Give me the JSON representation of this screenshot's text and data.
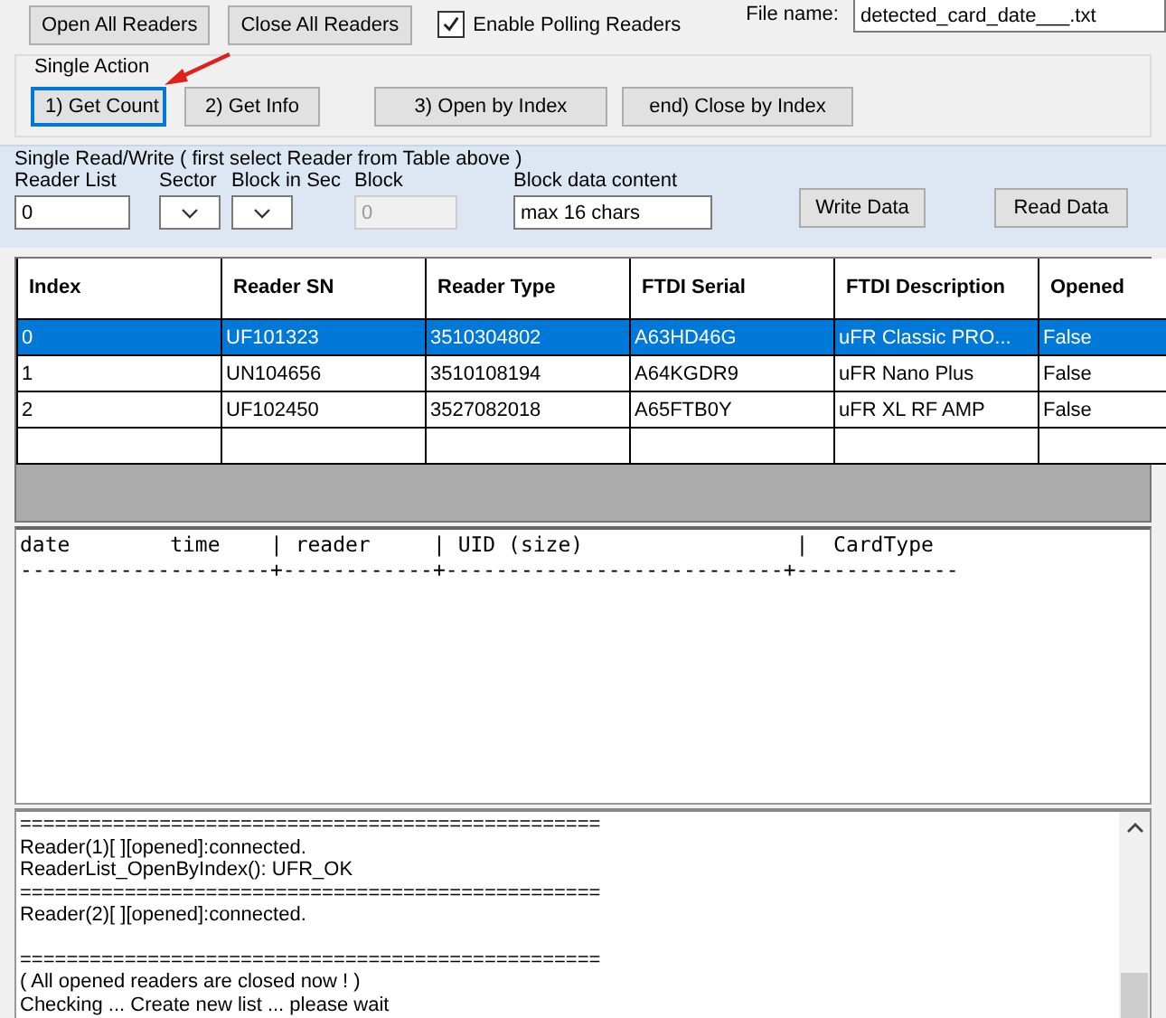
{
  "top_buttons": [
    "Open All Readers",
    "Close All Readers"
  ],
  "polling": {
    "label": "Enable Polling Readers",
    "checked": true
  },
  "file_name": {
    "label": "File name:",
    "value": "detected_card_date___.txt"
  },
  "single_action": {
    "title": "Single Action",
    "buttons": [
      {
        "label": "1) Get Count",
        "focused": true
      },
      {
        "label": "2) Get Info",
        "focused": false
      },
      {
        "label": "3) Open by Index",
        "focused": false
      },
      {
        "label": "end) Close by Index",
        "focused": false
      }
    ]
  },
  "read_write": {
    "title": "Single Read/Write  ( first select Reader from Table above )",
    "fields": [
      {
        "kind": "text",
        "label": "Reader List",
        "value": "0",
        "disabled": false
      },
      {
        "kind": "dropdown",
        "label": "Sector",
        "disabled": false
      },
      {
        "kind": "dropdown",
        "label": "Block in Sec",
        "disabled": false
      },
      {
        "kind": "text",
        "label": "Block",
        "value": "0",
        "disabled": true
      },
      {
        "kind": "text",
        "label": "Block data content",
        "value": "max 16 chars",
        "disabled": false
      }
    ],
    "buttons": [
      "Write Data",
      "Read Data"
    ]
  },
  "table": {
    "columns": [
      "Index",
      "Reader SN",
      "Reader Type",
      "FTDI Serial",
      "FTDI Description",
      "Opened"
    ],
    "rows": [
      {
        "cells": [
          "0",
          "UF101323",
          "3510304802",
          "A63HD46G",
          "uFR Classic PRO...",
          "False"
        ],
        "selected": true
      },
      {
        "cells": [
          "1",
          "UN104656",
          "3510108194",
          "A64KGDR9",
          "uFR Nano Plus",
          "False"
        ],
        "selected": false
      },
      {
        "cells": [
          "2",
          "UF102450",
          "3527082018",
          "A65FTB0Y",
          "uFR XL RF AMP",
          "False"
        ],
        "selected": false
      }
    ]
  },
  "card_log": {
    "header": "date        time    | reader     | UID (size)                 |  CardType",
    "rule": "--------------------+------------+---------------------------+-------------"
  },
  "message_log": [
    {
      "text": "==================================================",
      "gap_before": false
    },
    {
      "text": "Reader(1)[ ][opened]:connected.",
      "gap_before": false
    },
    {
      "text": "ReaderList_OpenByIndex(): UFR_OK",
      "gap_before": false
    },
    {
      "text": "==================================================",
      "gap_before": false
    },
    {
      "text": "Reader(2)[ ][opened]:connected.",
      "gap_before": false
    },
    {
      "text": "==================================================",
      "gap_before": true
    },
    {
      "text": "( All opened readers are closed now ! )",
      "gap_before": false
    },
    {
      "text": "Checking ... Create new list ... please wait",
      "gap_before": false
    }
  ]
}
